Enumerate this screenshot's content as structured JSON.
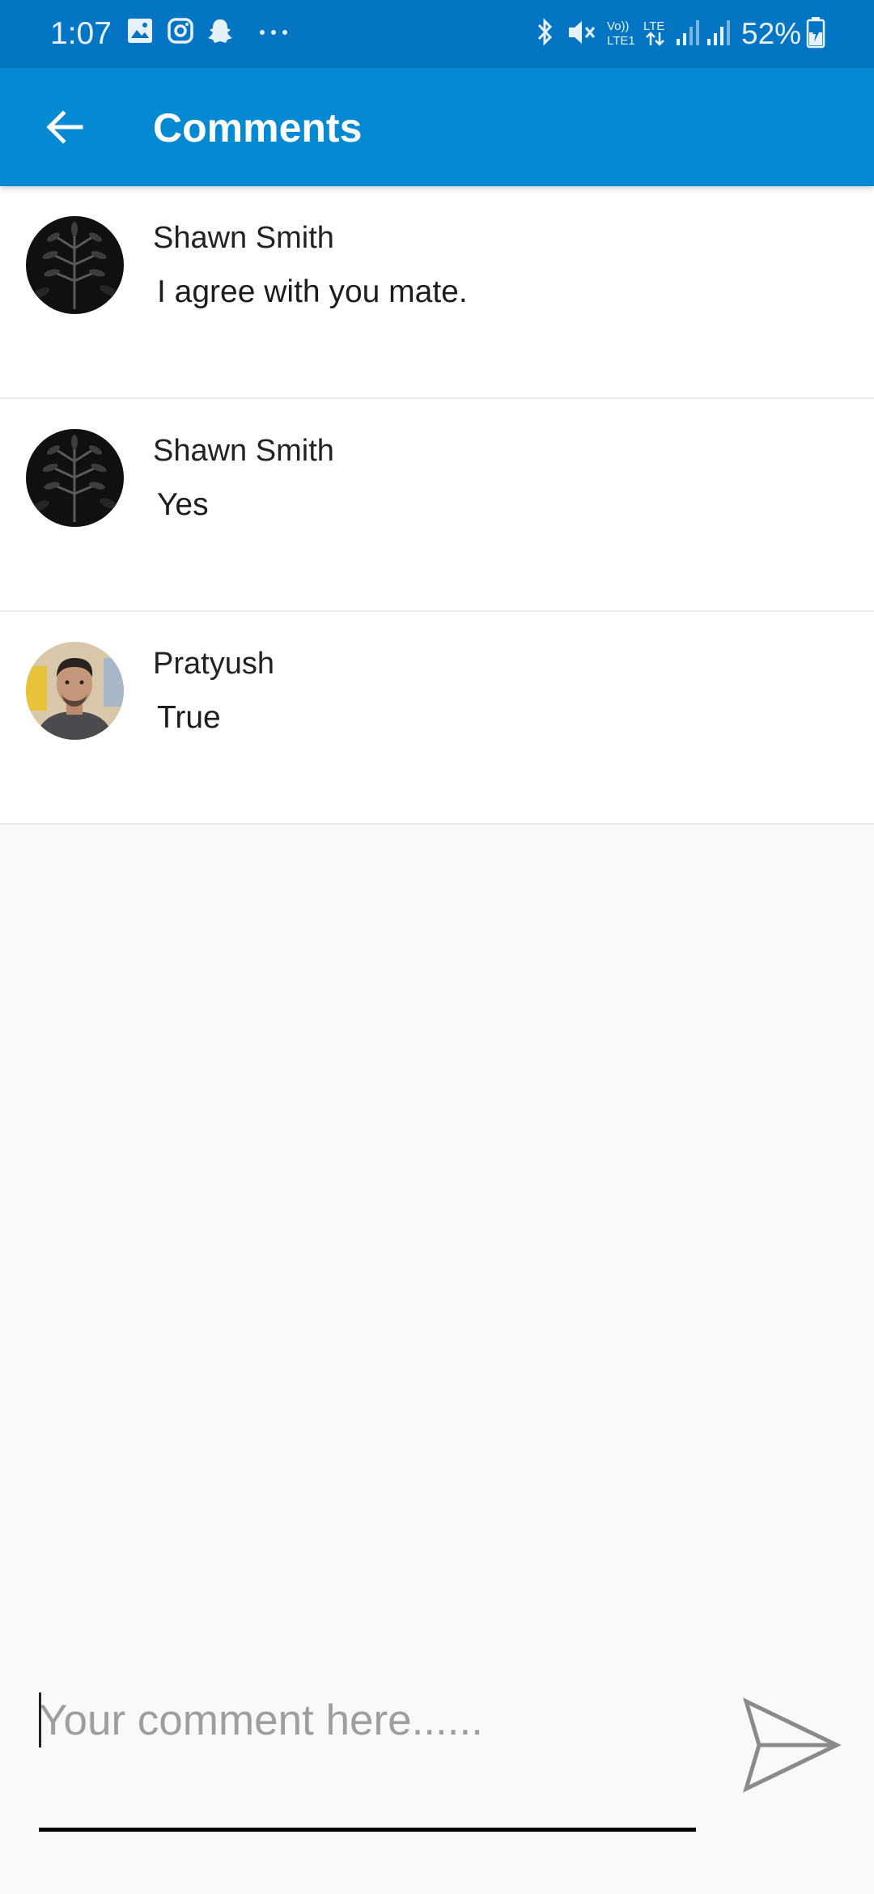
{
  "status_bar": {
    "time": "1:07",
    "battery": "52%",
    "left_icons": [
      "image-icon",
      "instagram-icon",
      "snapchat-icon",
      "more-dots-icon"
    ],
    "right_icons": [
      "bluetooth-icon",
      "mute-icon",
      "volte-icon",
      "lte-icon",
      "signal-icon",
      "signal-icon",
      "battery-charging-icon"
    ]
  },
  "app_bar": {
    "title": "Comments",
    "back_icon": "arrow-left-icon",
    "background": "#0489d3"
  },
  "comments": [
    {
      "author": "Shawn Smith",
      "text": "I agree with you mate.",
      "avatar": "dark-leaves-avatar"
    },
    {
      "author": "Shawn Smith",
      "text": "Yes",
      "avatar": "dark-leaves-avatar"
    },
    {
      "author": "Pratyush",
      "text": "True",
      "avatar": "person-photo-avatar"
    }
  ],
  "composer": {
    "placeholder": "Your comment here......",
    "value": "",
    "send_icon": "send-icon"
  },
  "colors": {
    "status_bar": "#0475c3",
    "accent": "#0489d3",
    "background": "#f9f9f9"
  }
}
